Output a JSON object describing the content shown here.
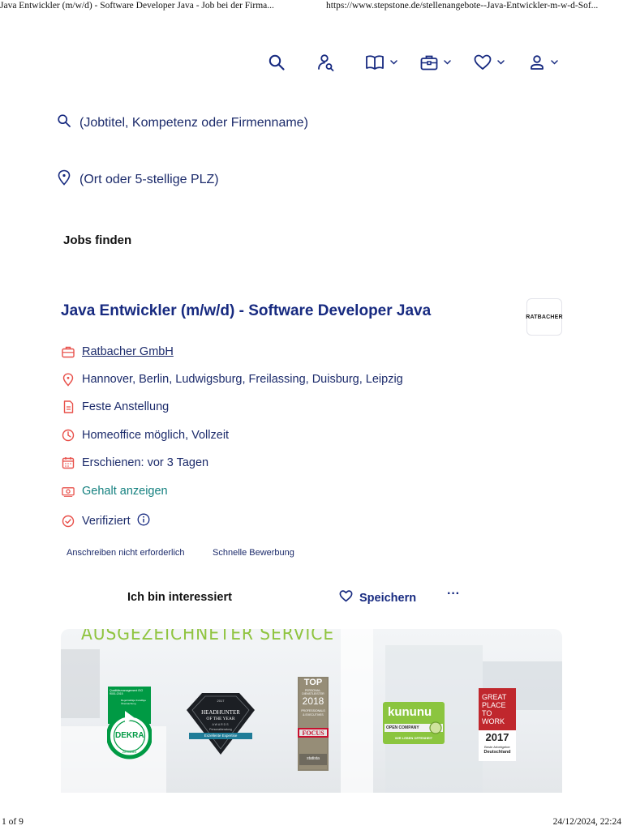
{
  "print": {
    "page_title": "Java Entwickler (m/w/d) - Software Developer Java - Job bei der Firma...",
    "url": "https://www.stepstone.de/stellenangebote--Java-Entwickler-m-w-d-Sof...",
    "page_counter": "1 of 9",
    "datetime": "24/12/2024, 22:24"
  },
  "nav": {
    "icons": [
      "search-icon",
      "user-search-icon",
      "book-icon",
      "briefcase-icon",
      "heart-icon",
      "user-icon"
    ]
  },
  "search": {
    "keyword_placeholder": "(Jobtitel, Kompetenz oder Firmenname)",
    "location_placeholder": "(Ort oder 5-stellige PLZ)",
    "submit_label": "Jobs finden"
  },
  "job": {
    "title": "Java Entwickler (m/w/d) - Software Developer Java",
    "company_logo_text": "RATBACHER",
    "company": "Ratbacher GmbH",
    "locations": "Hannover, Berlin, Ludwigsburg, Freilassing, Duisburg, Leipzig",
    "contract": "Feste Anstellung",
    "work_mode": "Homeoffice möglich, Vollzeit",
    "posted": "Erschienen: vor 3 Tagen",
    "salary_link": "Gehalt anzeigen",
    "verified": "Verifiziert",
    "tags": [
      "Anschreiben nicht erforderlich",
      "Schnelle Bewerbung"
    ]
  },
  "actions": {
    "apply_label": "Ich bin interessiert",
    "save_label": "Speichern",
    "more_label": "···"
  },
  "banner": {
    "headline": "AUSGEZEICHNETER SERVICE",
    "awards": {
      "dekra": {
        "top_text": "Qualitätsmanagement ISO 9001:2015",
        "sub_text": "Regelmäßige freiwillige Überwachung",
        "name": "DEKRA",
        "certified": "Zertifiziert"
      },
      "headhunter": {
        "year": "2017",
        "line1": "HEADHUNTER",
        "line2": "OF THE YEAR",
        "line3": "AWARDS",
        "line4": "Personalberatung",
        "ribbon": "Exzellente Expertise"
      },
      "focus": {
        "top": "TOP",
        "line1": "PERSONAL-",
        "line2": "DIENSTLEISTER",
        "year": "2018",
        "line3": "PROFESSIONALS",
        "line4": "& EXECUTIVES",
        "brand": "FOCUS",
        "source": "statista"
      },
      "kununu": {
        "name": "kununu",
        "badge": "OPEN COMPANY",
        "footer": "WIR LEBEN OFFENHEIT"
      },
      "gptw": {
        "line1": "GREAT",
        "line2": "PLACE",
        "line3": "TO",
        "line4": "WORK",
        "year": "2017",
        "sub": "Beste Arbeitgeber",
        "country": "Deutschland"
      }
    },
    "colors": {
      "headline": "#8fc43f",
      "dekra": "#009a44",
      "kununu": "#8bc53f",
      "gptw": "#c0272d"
    }
  },
  "colors": {
    "navy": "#172a80",
    "icon_red": "#e8504a",
    "teal": "#14807f"
  }
}
